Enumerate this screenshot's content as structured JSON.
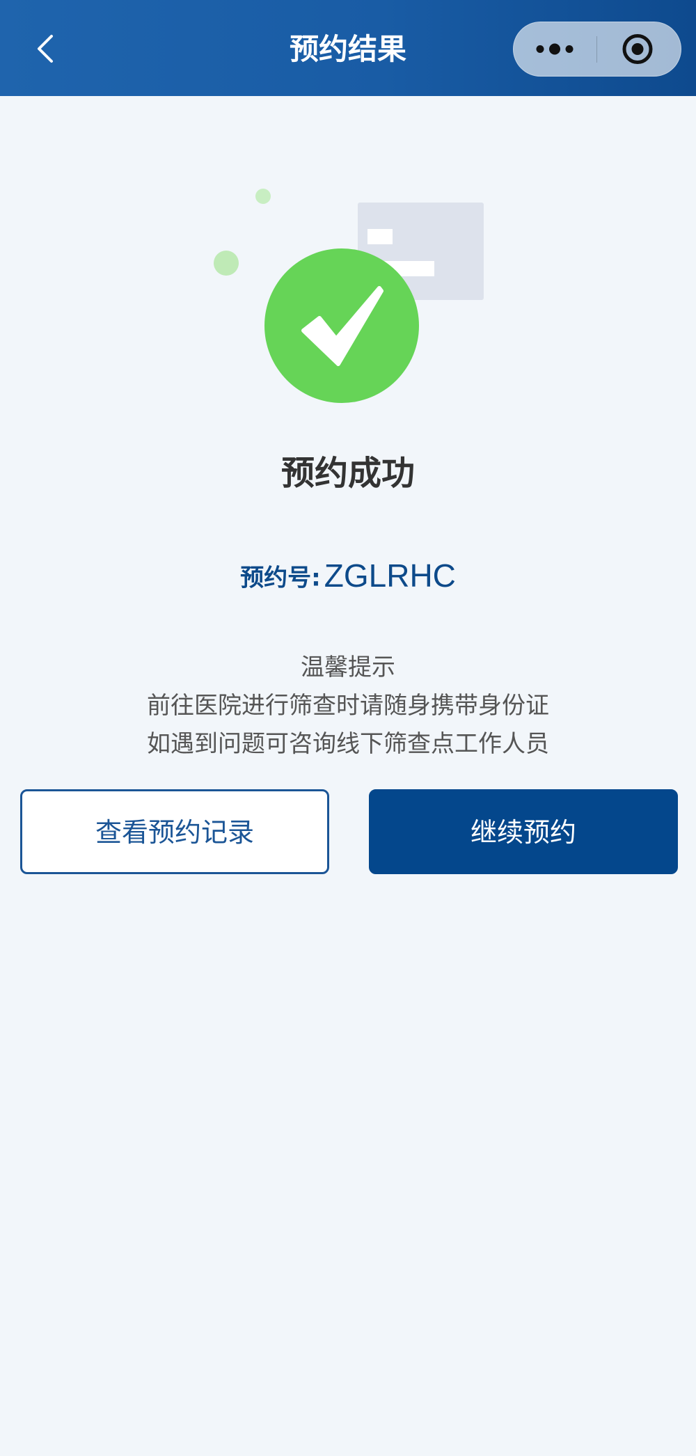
{
  "nav": {
    "title": "预约结果",
    "back_icon": "chevron-left-icon",
    "more_icon": "more-dots-icon",
    "close_icon": "target-close-icon"
  },
  "result": {
    "status": "预约成功",
    "icon": "success-check-icon",
    "success_color": "#66d457"
  },
  "booking": {
    "label": "预约号:",
    "code": "ZGLRHC"
  },
  "tips": {
    "title": "温馨提示",
    "line1": "前往医院进行筛查时请随身携带身份证",
    "line2": "如遇到问题可咨询线下筛查点工作人员"
  },
  "actions": {
    "view_records": "查看预约记录",
    "continue": "继续预约"
  },
  "colors": {
    "primary": "#04478c",
    "header": "#195ca5",
    "background": "#f2f6fa"
  }
}
